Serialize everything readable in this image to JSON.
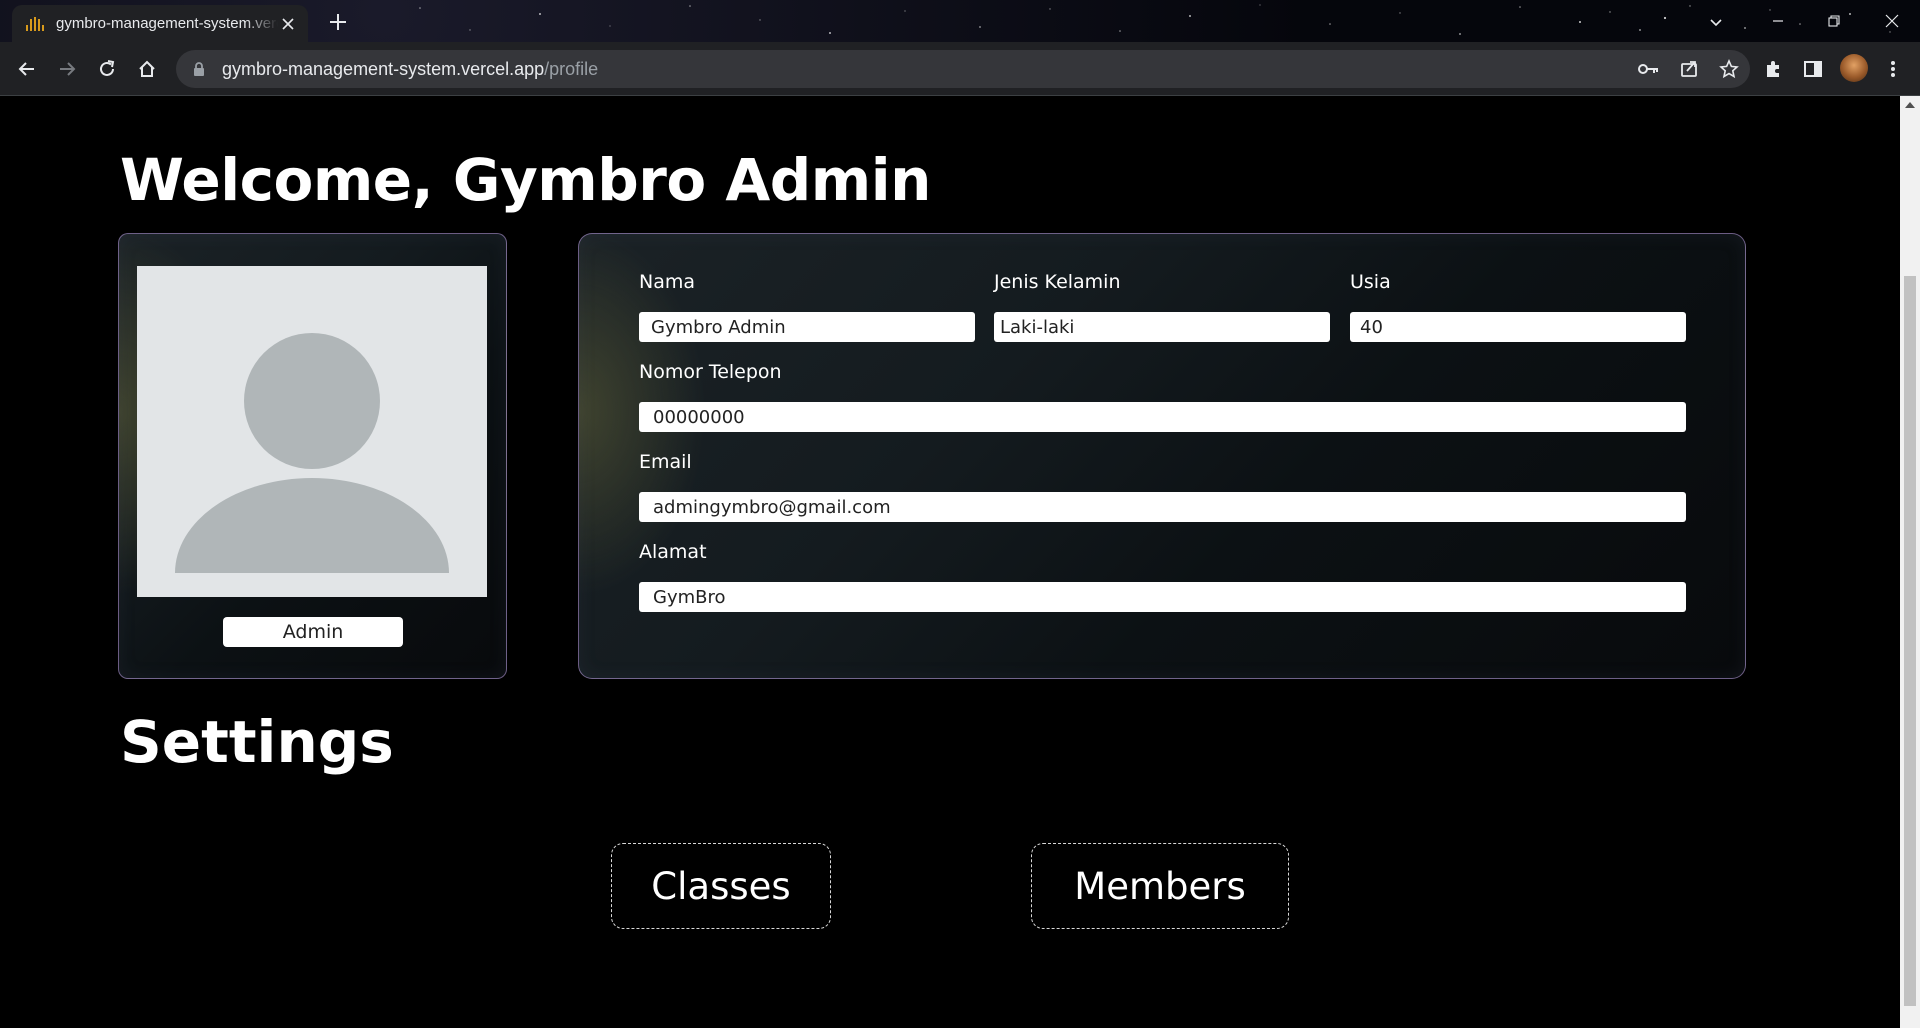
{
  "browser": {
    "tab_title": "gymbro-management-system.vercel.app",
    "tab_close_icon": "close-icon",
    "new_tab_icon": "plus-icon",
    "url_host": "gymbro-management-system.vercel.app",
    "url_path": "/profile",
    "toolbar_icons": [
      "back-icon",
      "forward-icon",
      "reload-icon",
      "home-icon",
      "key-icon",
      "share-icon",
      "star-icon",
      "extensions-icon",
      "side-panel-icon",
      "avatar",
      "more-icon"
    ],
    "window_controls": [
      "minimize-icon",
      "restore-icon",
      "close-icon"
    ]
  },
  "page": {
    "welcome": "Welcome, Gymbro Admin",
    "profile": {
      "role": "Admin"
    },
    "fields": {
      "nama": {
        "label": "Nama",
        "value": "Gymbro Admin"
      },
      "jenis_kelamin": {
        "label": "Jenis Kelamin",
        "value": "Laki-laki"
      },
      "usia": {
        "label": "Usia",
        "value": "40"
      },
      "telepon": {
        "label": "Nomor Telepon",
        "value": "00000000"
      },
      "email": {
        "label": "Email",
        "value": "admingymbro@gmail.com"
      },
      "alamat": {
        "label": "Alamat",
        "value": "GymBro"
      }
    },
    "settings_title": "Settings",
    "buttons": {
      "classes": "Classes",
      "members": "Members"
    }
  },
  "colors": {
    "background": "#000000",
    "card_border": "#bea0e6",
    "chrome": "#202124",
    "omnibox": "#35363a"
  }
}
